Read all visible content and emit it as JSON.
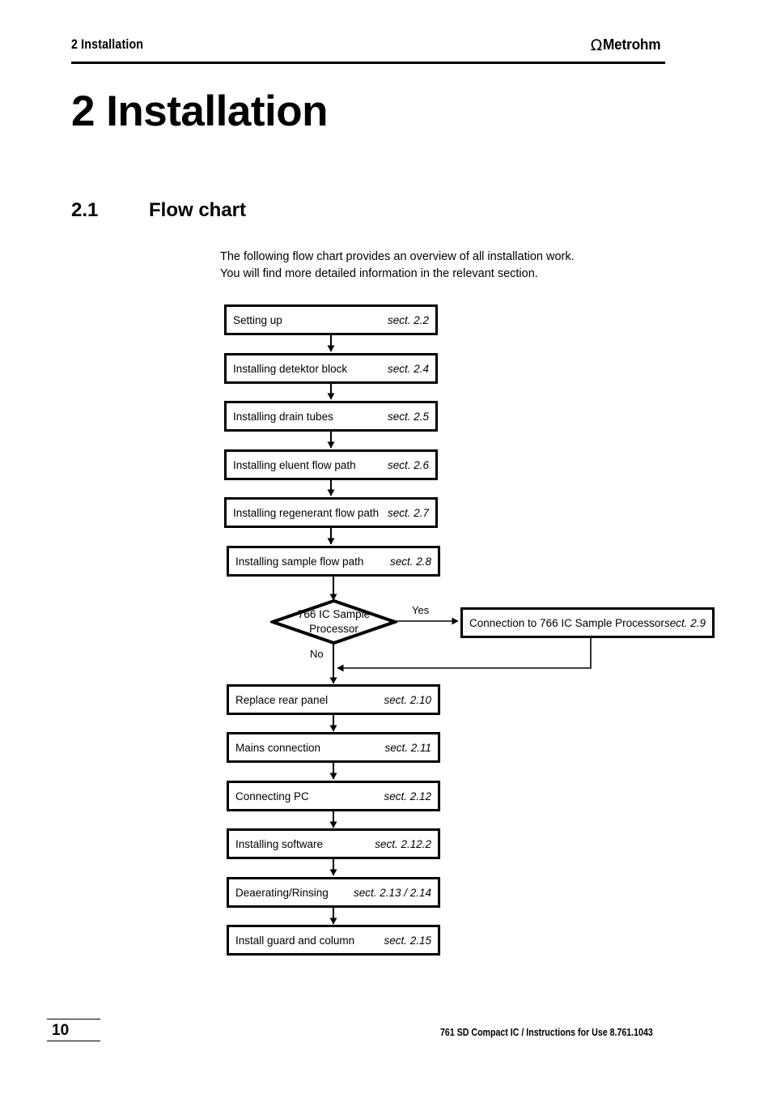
{
  "header": {
    "chapter_label": "2  Installation",
    "logo_symbol": "Ω",
    "logo_brand": "Metrohm"
  },
  "chapter": {
    "title": "2 Installation"
  },
  "section": {
    "number": "2.1",
    "title": "Flow chart"
  },
  "intro": {
    "line1": "The following flow chart provides an overview of all installation work.",
    "line2": "You will find more detailed information in the relevant section."
  },
  "flowchart": {
    "steps": [
      {
        "label": "Setting up",
        "section": "sect. 2.2"
      },
      {
        "label": "Installing detektor block",
        "section": "sect. 2.4"
      },
      {
        "label": "Installing drain tubes",
        "section": "sect. 2.5"
      },
      {
        "label": "Installing eluent flow path",
        "section": "sect. 2.6"
      },
      {
        "label": "Installing regenerant flow path",
        "section": "sect. 2.7"
      },
      {
        "label": "Installing sample flow path",
        "section": "sect. 2.8"
      }
    ],
    "decision": {
      "line1": "766 IC Sample",
      "line2": "Processor",
      "yes_label": "Yes",
      "no_label": "No"
    },
    "branch": {
      "label": "Connection to 766 IC Sample Processor",
      "section": "sect. 2.9"
    },
    "steps_after": [
      {
        "label": "Replace rear panel",
        "section": "sect. 2.10"
      },
      {
        "label": "Mains connection",
        "section": "sect. 2.11"
      },
      {
        "label": "Connecting PC",
        "section": "sect. 2.12"
      },
      {
        "label": "Installing software",
        "section": "sect. 2.12.2"
      },
      {
        "label": "Deaerating/Rinsing",
        "section": "sect. 2.13 / 2.14"
      },
      {
        "label": "Install guard and column",
        "section": "sect. 2.15"
      }
    ]
  },
  "footer": {
    "page_number": "10",
    "document": "761 SD Compact IC / Instructions for Use  8.761.1043"
  }
}
